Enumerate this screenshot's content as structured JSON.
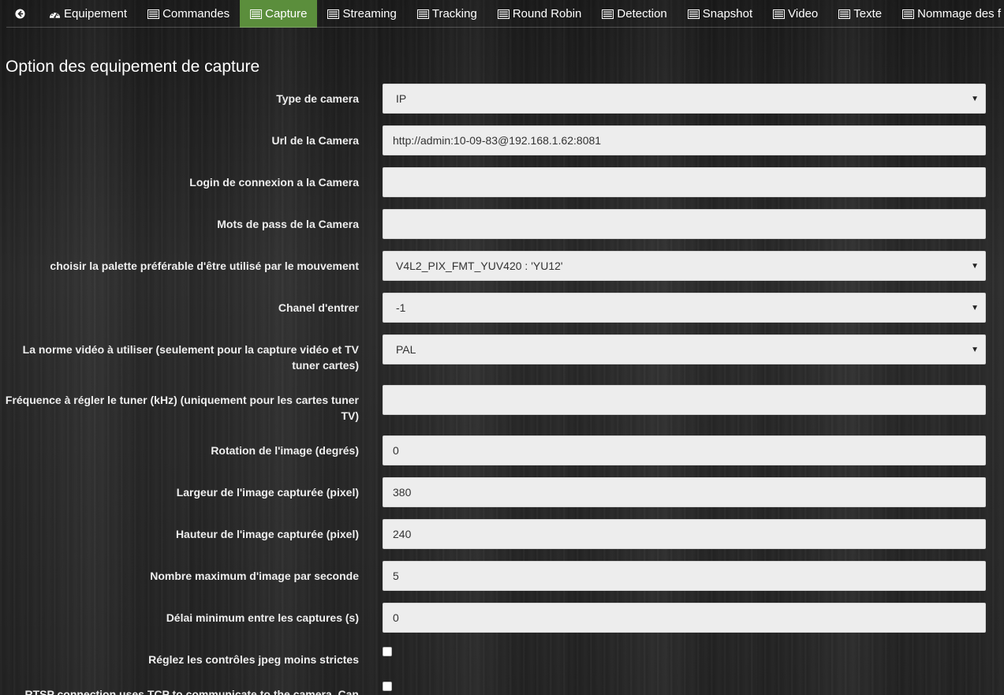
{
  "nav": {
    "back_icon": "arrow-circle-left-icon",
    "items": [
      {
        "label": "Equipement",
        "icon": "dashboard-icon",
        "active": false
      },
      {
        "label": "Commandes",
        "icon": "list-alt-icon",
        "active": false
      },
      {
        "label": "Capture",
        "icon": "list-alt-icon",
        "active": true
      },
      {
        "label": "Streaming",
        "icon": "list-alt-icon",
        "active": false
      },
      {
        "label": "Tracking",
        "icon": "list-alt-icon",
        "active": false
      },
      {
        "label": "Round Robin",
        "icon": "list-alt-icon",
        "active": false
      },
      {
        "label": "Detection",
        "icon": "list-alt-icon",
        "active": false
      },
      {
        "label": "Snapshot",
        "icon": "list-alt-icon",
        "active": false
      },
      {
        "label": "Video",
        "icon": "list-alt-icon",
        "active": false
      },
      {
        "label": "Texte",
        "icon": "list-alt-icon",
        "active": false
      },
      {
        "label": "Nommage des f",
        "icon": "list-alt-icon",
        "active": false
      }
    ],
    "active_color": "#5b8e3c"
  },
  "page": {
    "title": "Option des equipement de capture"
  },
  "form": {
    "camera_type": {
      "label": "Type de camera",
      "value": "IP"
    },
    "camera_url": {
      "label": "Url de la Camera",
      "value": "http://admin:10-09-83@192.168.1.62:8081"
    },
    "camera_login": {
      "label": "Login de connexion a la Camera",
      "value": ""
    },
    "camera_password": {
      "label": "Mots de pass de la Camera",
      "value": ""
    },
    "palette": {
      "label": "choisir la palette préférable d'être utilisé par le mouvement",
      "value": "V4L2_PIX_FMT_YUV420 : 'YU12'"
    },
    "input_channel": {
      "label": "Chanel d'entrer",
      "value": "-1"
    },
    "video_norm": {
      "label": "La norme vidéo à utiliser (seulement pour la capture vidéo et TV tuner cartes)",
      "value": "PAL"
    },
    "tuner_frequency": {
      "label": "Fréquence à régler le tuner (kHz) (uniquement pour les cartes tuner TV)",
      "value": ""
    },
    "rotation": {
      "label": "Rotation de l'image (degrés)",
      "value": "0"
    },
    "width": {
      "label": "Largeur de l'image capturée (pixel)",
      "value": "380"
    },
    "height": {
      "label": "Hauteur de l'image capturée (pixel)",
      "value": "240"
    },
    "max_fps": {
      "label": "Nombre maximum d'image par seconde",
      "value": "5"
    },
    "min_delay": {
      "label": "Délai minimum entre les captures (s)",
      "value": "0"
    },
    "jpeg_relaxed": {
      "label": "Réglez les contrôles jpeg moins strictes",
      "checked": false
    },
    "rtsp_tcp": {
      "label": "RTSP connection uses TCP to communicate to the camera. Can",
      "checked": false
    }
  }
}
